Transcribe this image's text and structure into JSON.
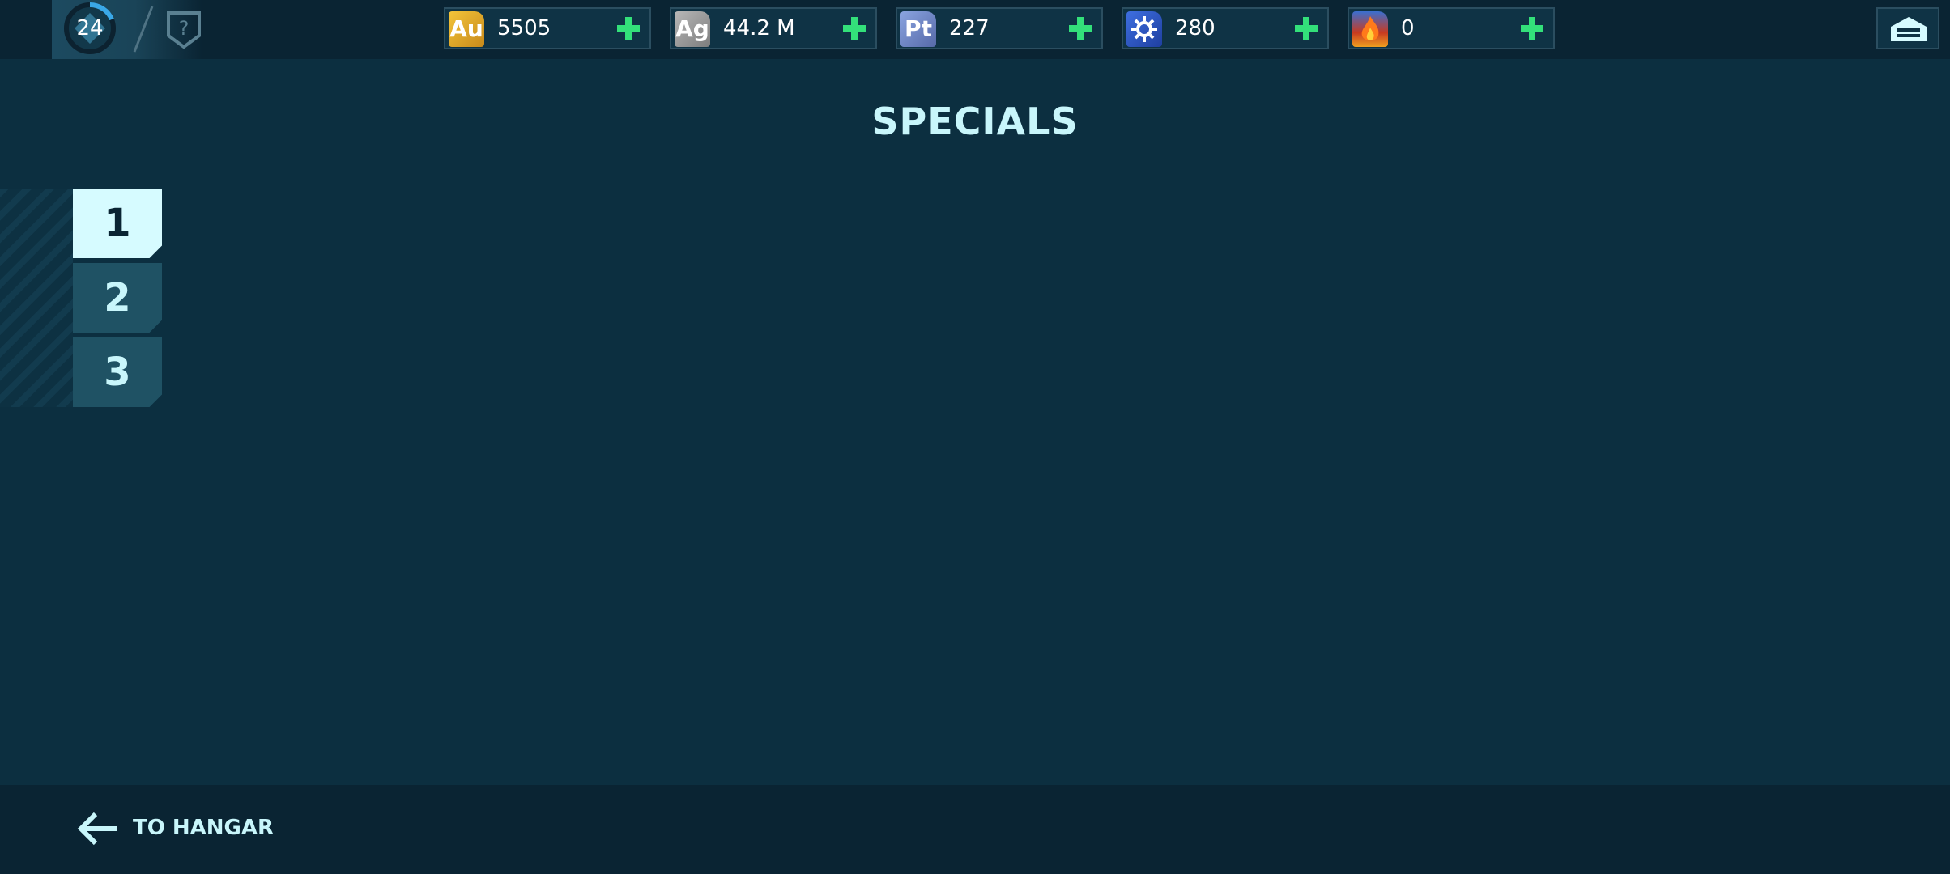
{
  "header": {
    "level": "24",
    "rank_icon": "question-shield-icon",
    "resources": [
      {
        "code": "Au",
        "value": "5505",
        "color": "#e0a825",
        "icon": "gold-icon"
      },
      {
        "code": "Ag",
        "value": "44.2 M",
        "color": "#9a9a9a",
        "icon": "silver-icon"
      },
      {
        "code": "Pt",
        "value": "227",
        "color": "#6f88c8",
        "icon": "platinum-icon"
      },
      {
        "code": "",
        "value": "280",
        "color": "#2f5fd0",
        "icon": "key-gear-icon"
      },
      {
        "code": "",
        "value": "0",
        "color": "#e04a1a",
        "icon": "fire-icon"
      }
    ],
    "add_icon": "plus-icon",
    "hangar_icon": "hangar-icon"
  },
  "page": {
    "title": "SPECIALS"
  },
  "tabs": [
    {
      "label": "1",
      "active": true
    },
    {
      "label": "2",
      "active": false
    },
    {
      "label": "3",
      "active": false
    }
  ],
  "footer": {
    "back_label": "TO HANGAR",
    "back_icon": "arrow-left-icon"
  },
  "colors": {
    "background": "#0c2f40",
    "bar": "#0a2433",
    "accent_text": "#c8f6fb",
    "plus_green": "#33e07a",
    "active_tab": "#d6fbff"
  }
}
